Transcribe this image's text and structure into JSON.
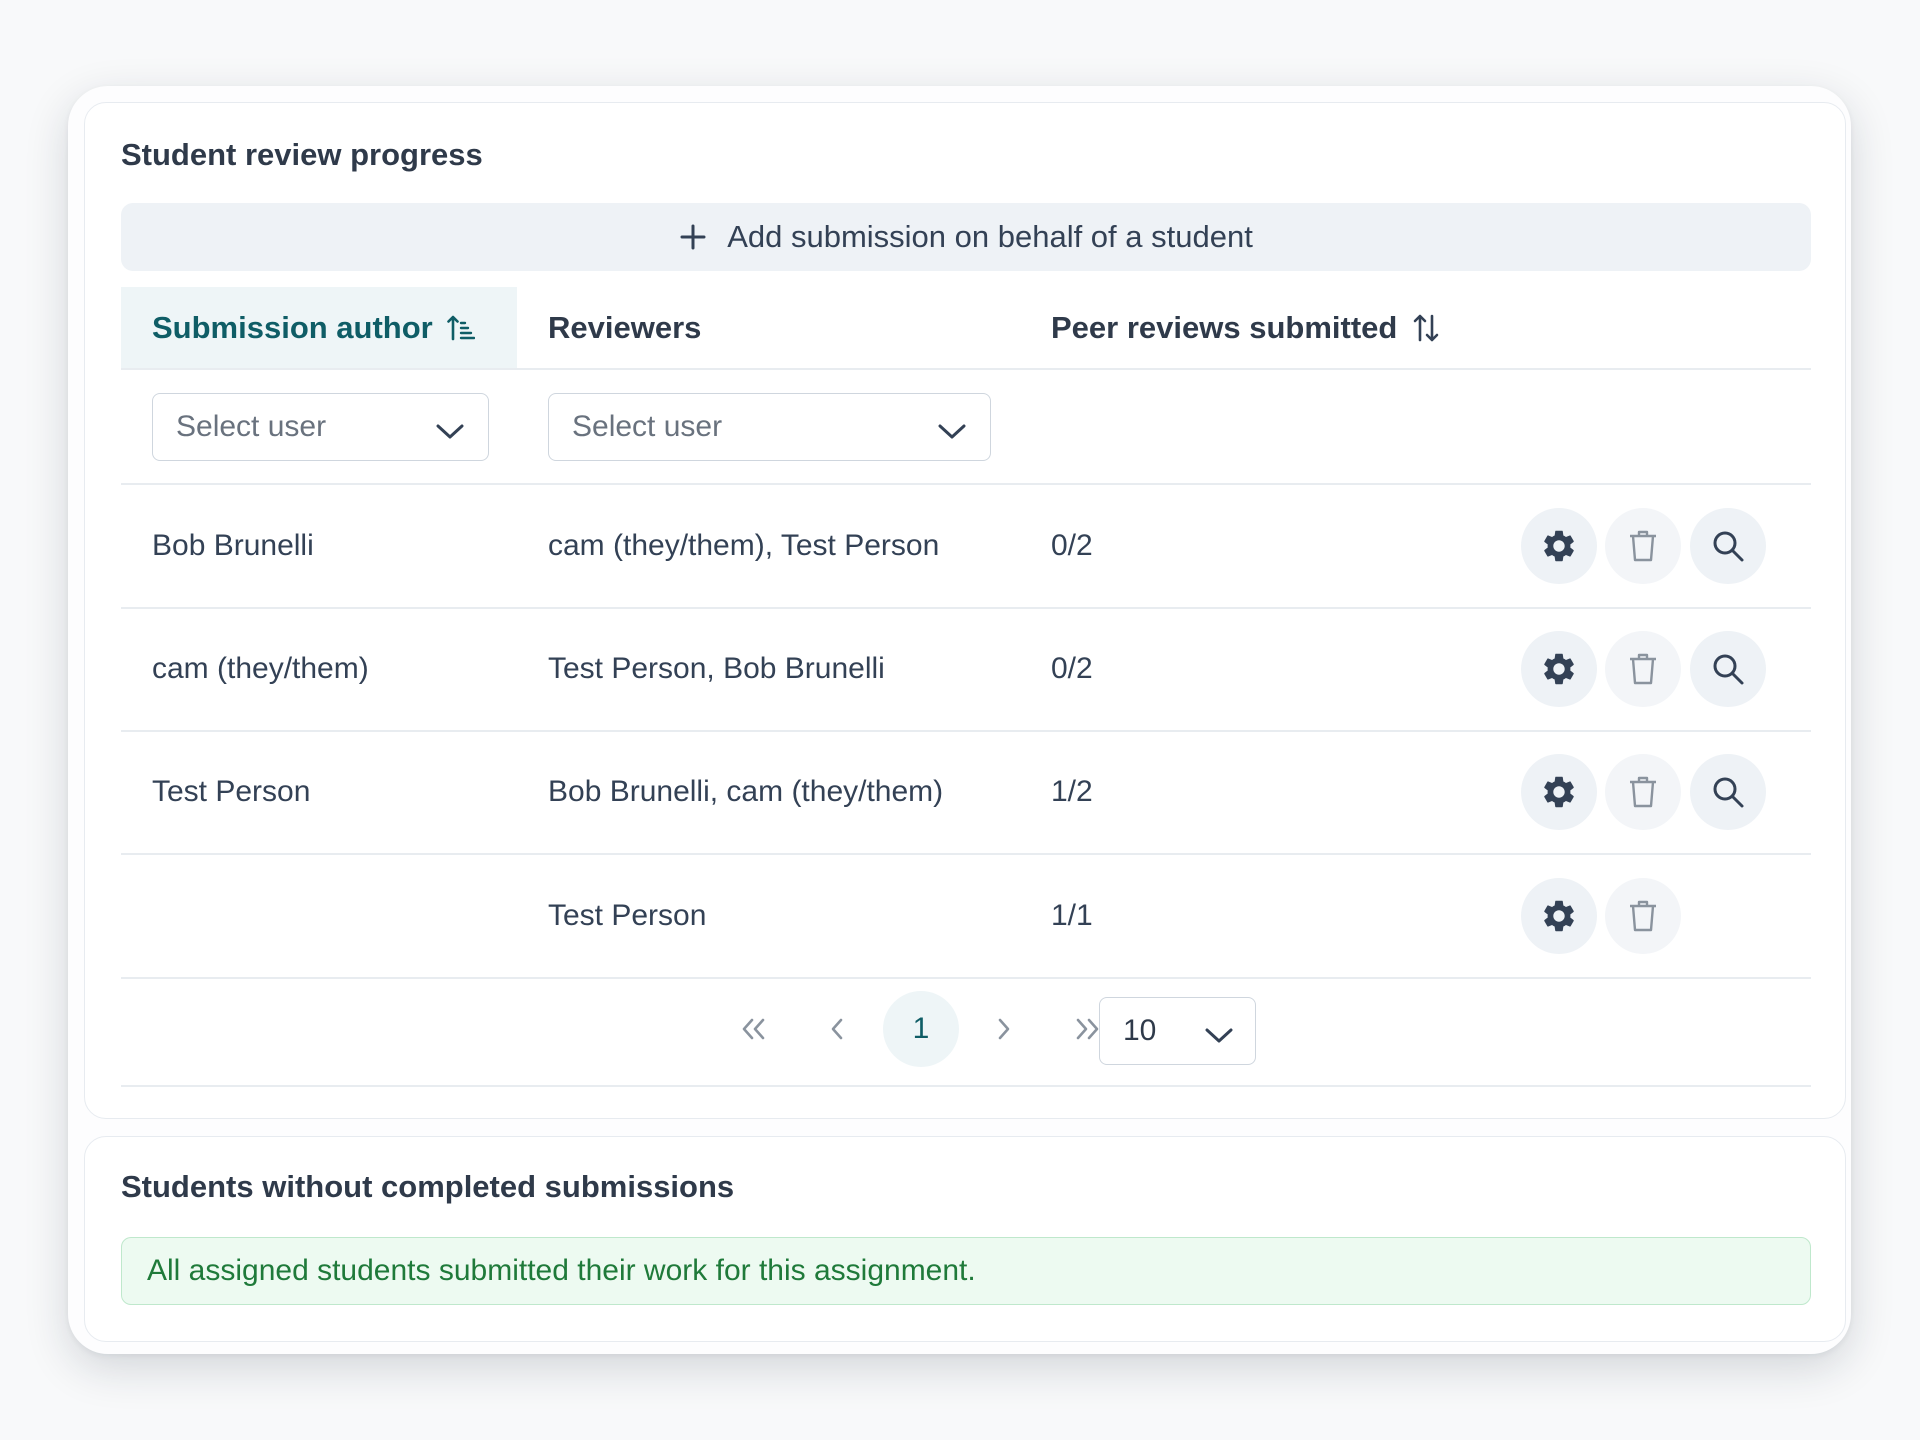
{
  "review_progress": {
    "title": "Student review progress",
    "add_button_label": "Add submission on behalf of a student",
    "columns": {
      "author": "Submission author",
      "reviewers": "Reviewers",
      "peer_reviews": "Peer reviews submitted"
    },
    "filters": {
      "author_placeholder": "Select user",
      "reviewers_placeholder": "Select user"
    },
    "rows": [
      {
        "author": "Bob Brunelli",
        "reviewers": "cam (they/them), Test Person",
        "peer_reviews": "0/2"
      },
      {
        "author": "cam (they/them)",
        "reviewers": "Test Person, Bob Brunelli",
        "peer_reviews": "0/2"
      },
      {
        "author": "Test Person",
        "reviewers": "Bob Brunelli, cam (they/them)",
        "peer_reviews": "1/2"
      },
      {
        "author": "",
        "reviewers": "Test Person",
        "peer_reviews": "1/1"
      }
    ],
    "pagination": {
      "current_page": "1",
      "page_size": "10"
    }
  },
  "without_submissions": {
    "title": "Students without completed submissions",
    "notice": "All assigned students submitted their work for this assignment."
  },
  "colors": {
    "accent": "#0f5d66",
    "success_text": "#1f7a3a",
    "success_bg": "#edfaf1",
    "button_bg": "#eef2f6"
  },
  "icons": {
    "add": "plus-icon",
    "sort_active": "sort-ascending-icon",
    "sort": "sort-icon",
    "dropdown": "chevron-down-icon",
    "settings": "gear-icon",
    "delete": "trash-icon",
    "view": "search-icon",
    "first": "chevrons-left-icon",
    "prev": "chevron-left-icon",
    "next": "chevron-right-icon",
    "last": "chevrons-right-icon"
  }
}
